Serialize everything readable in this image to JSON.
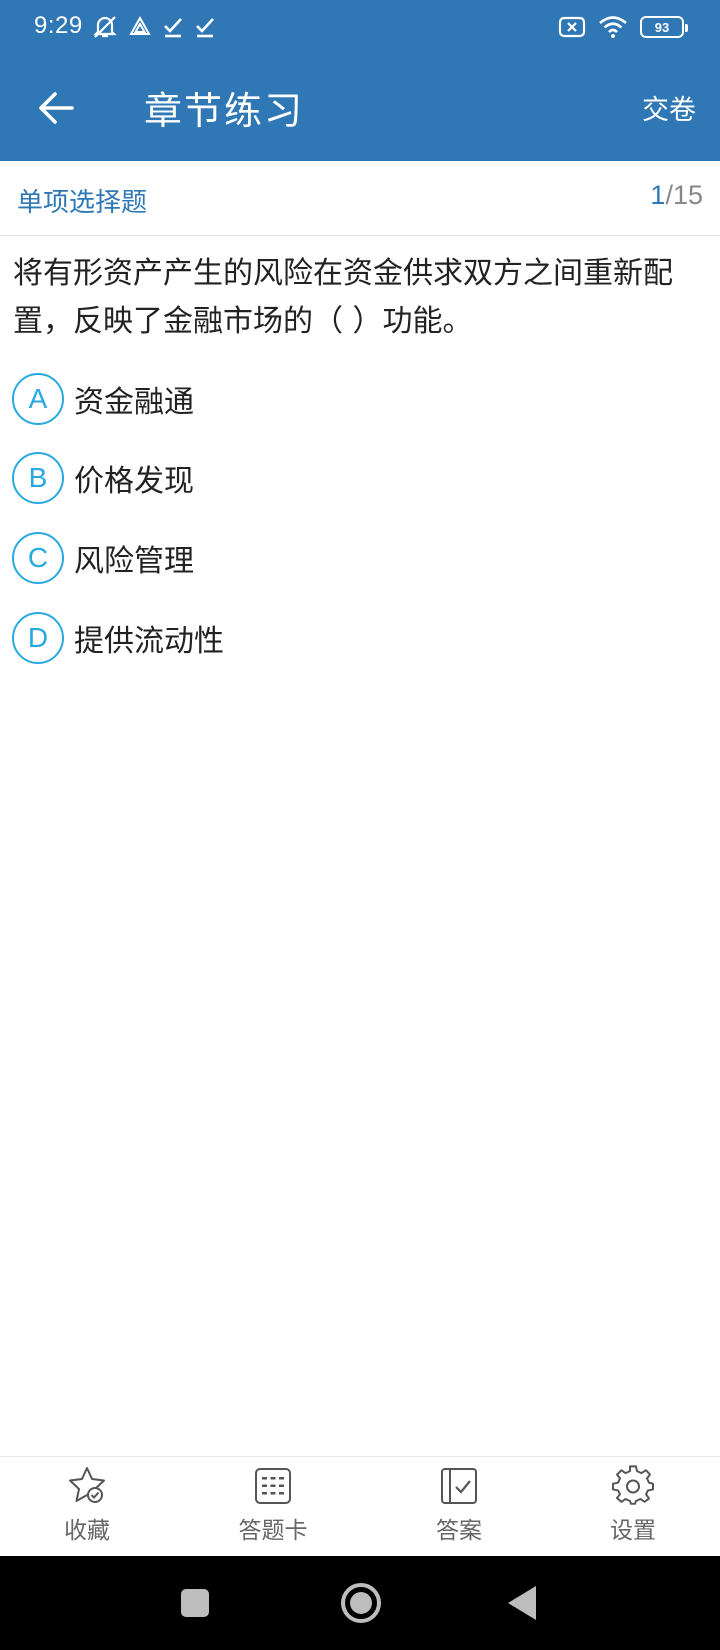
{
  "status_bar": {
    "time": "9:29",
    "battery": "93",
    "icons": [
      "mute-icon",
      "drive-icon",
      "check-icon",
      "check-icon",
      "data-off-icon",
      "wifi-icon",
      "battery-icon"
    ]
  },
  "app_bar": {
    "title": "章节练习",
    "submit_label": "交卷",
    "back_icon": "arrow-left-icon"
  },
  "section": {
    "type_label": "单项选择题",
    "current": "1",
    "total": "/15"
  },
  "question": {
    "text": "将有形资产产生的风险在资金供求双方之间重新配置，反映了金融市场的（ ）功能。",
    "options": [
      {
        "letter": "A",
        "text": "资金融通"
      },
      {
        "letter": "B",
        "text": "价格发现"
      },
      {
        "letter": "C",
        "text": "风险管理"
      },
      {
        "letter": "D",
        "text": "提供流动性"
      }
    ]
  },
  "bottom_nav": {
    "items": [
      {
        "label": "收藏",
        "icon": "star-check-icon"
      },
      {
        "label": "答题卡",
        "icon": "answer-sheet-icon"
      },
      {
        "label": "答案",
        "icon": "answer-book-icon"
      },
      {
        "label": "设置",
        "icon": "gear-icon"
      }
    ]
  },
  "colors": {
    "primary": "#2f77b5",
    "option_accent": "#27a9e1"
  }
}
